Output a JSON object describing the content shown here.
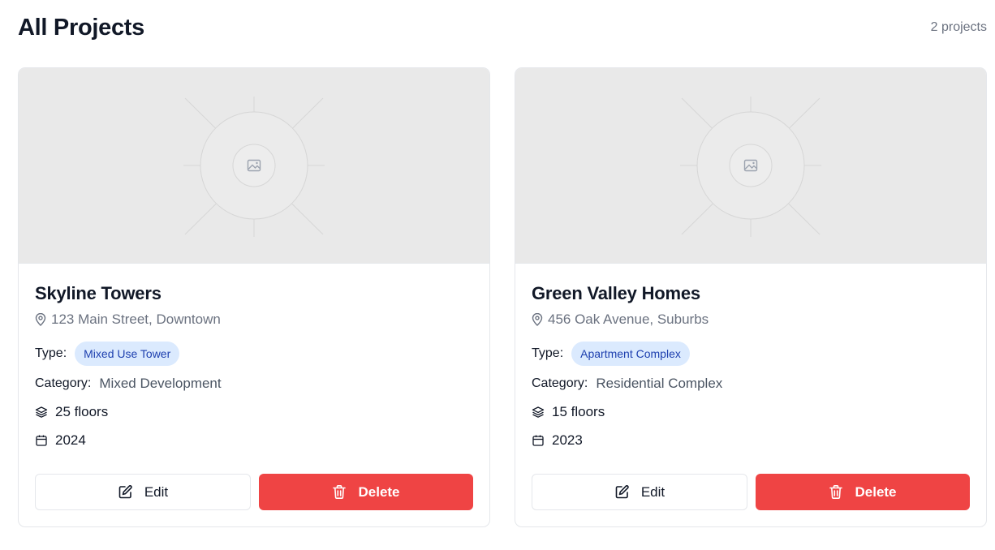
{
  "page": {
    "title": "All Projects",
    "count_label": "2 projects"
  },
  "icons": {
    "location": "map-pin-icon",
    "floors": "layers-icon",
    "year": "calendar-icon",
    "image": "image-icon",
    "edit": "edit-icon",
    "delete": "trash-icon"
  },
  "labels": {
    "type": "Type:",
    "category": "Category:",
    "edit": "Edit",
    "delete": "Delete"
  },
  "colors": {
    "delete_button": "#ef4444",
    "type_badge_bg": "#dbeafe",
    "type_badge_text": "#1e40af"
  },
  "projects": [
    {
      "name": "Skyline Towers",
      "address": "123 Main Street, Downtown",
      "type": "Mixed Use Tower",
      "category": "Mixed Development",
      "floors": "25 floors",
      "year": "2024"
    },
    {
      "name": "Green Valley Homes",
      "address": "456 Oak Avenue, Suburbs",
      "type": "Apartment Complex",
      "category": "Residential Complex",
      "floors": "15 floors",
      "year": "2023"
    }
  ]
}
